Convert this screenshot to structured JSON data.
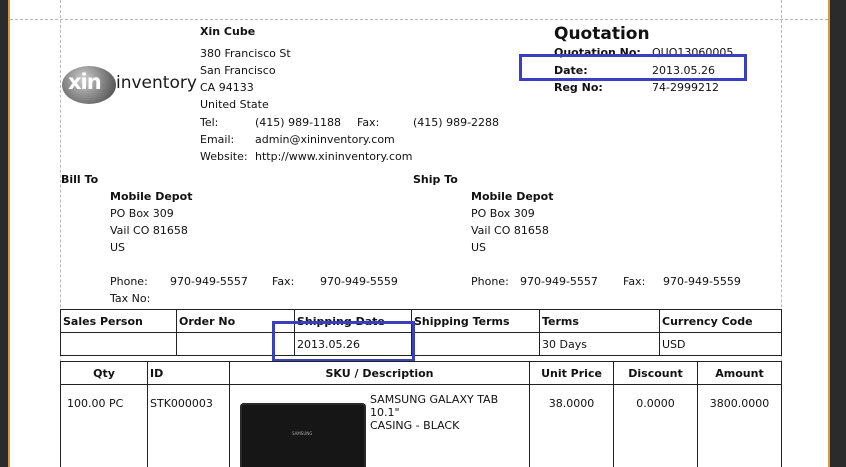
{
  "company": {
    "name": "Xin Cube",
    "address_lines": [
      "380 Francisco St",
      "San Francisco",
      "CA 94133",
      "United State"
    ],
    "tel_label": "Tel:",
    "tel": "(415) 989-1188",
    "fax_label": "Fax:",
    "fax": "(415) 989-2288",
    "email_label": "Email:",
    "email": "admin@xininventory.com",
    "website_label": "Website:",
    "website": "http://www.xininventory.com"
  },
  "logo": {
    "mark": "xin",
    "word": "inventory"
  },
  "doc": {
    "title": "Quotation",
    "quotation_no_label": "Quotation No:",
    "quotation_no": "QUO13060005",
    "date_label": "Date:",
    "date": "2013.05.26",
    "reg_no_label": "Reg No:",
    "reg_no": "74-2999212"
  },
  "bill_to": {
    "heading": "Bill To",
    "name": "Mobile Depot",
    "lines": [
      "PO Box 309",
      "Vail CO 81658",
      "US"
    ],
    "phone_label": "Phone:",
    "phone": "970-949-5557",
    "fax_label": "Fax:",
    "fax": "970-949-5559",
    "taxno_label": "Tax No:"
  },
  "ship_to": {
    "heading": "Ship To",
    "name": "Mobile Depot",
    "lines": [
      "PO Box 309",
      "Vail CO 81658",
      "US"
    ],
    "phone_label": "Phone:",
    "phone": "970-949-5557",
    "fax_label": "Fax:",
    "fax": "970-949-5559"
  },
  "order_table": {
    "headers": [
      "Sales Person",
      "Order No",
      "Shipping Date",
      "Shipping Terms",
      "Terms",
      "Currency Code"
    ],
    "values": [
      "",
      "",
      "2013.05.26",
      "",
      "30 Days",
      "USD"
    ]
  },
  "items_table": {
    "headers": [
      "Qty",
      "ID",
      "SKU / Description",
      "Unit Price",
      "Discount",
      "Amount"
    ],
    "rows": [
      {
        "qty": "100.00  PC",
        "id": "STK000003",
        "desc_line1": "SAMSUNG GALAXY TAB 10.1\"",
        "desc_line2": "CASING - BLACK",
        "unit_price": "38.0000",
        "discount": "0.0000",
        "amount": "3800.0000"
      }
    ]
  },
  "product_image": {
    "brand": "SAMSUNG"
  },
  "colors": {
    "highlight": "#3a3fbd",
    "window_border": "#d59a3c"
  }
}
